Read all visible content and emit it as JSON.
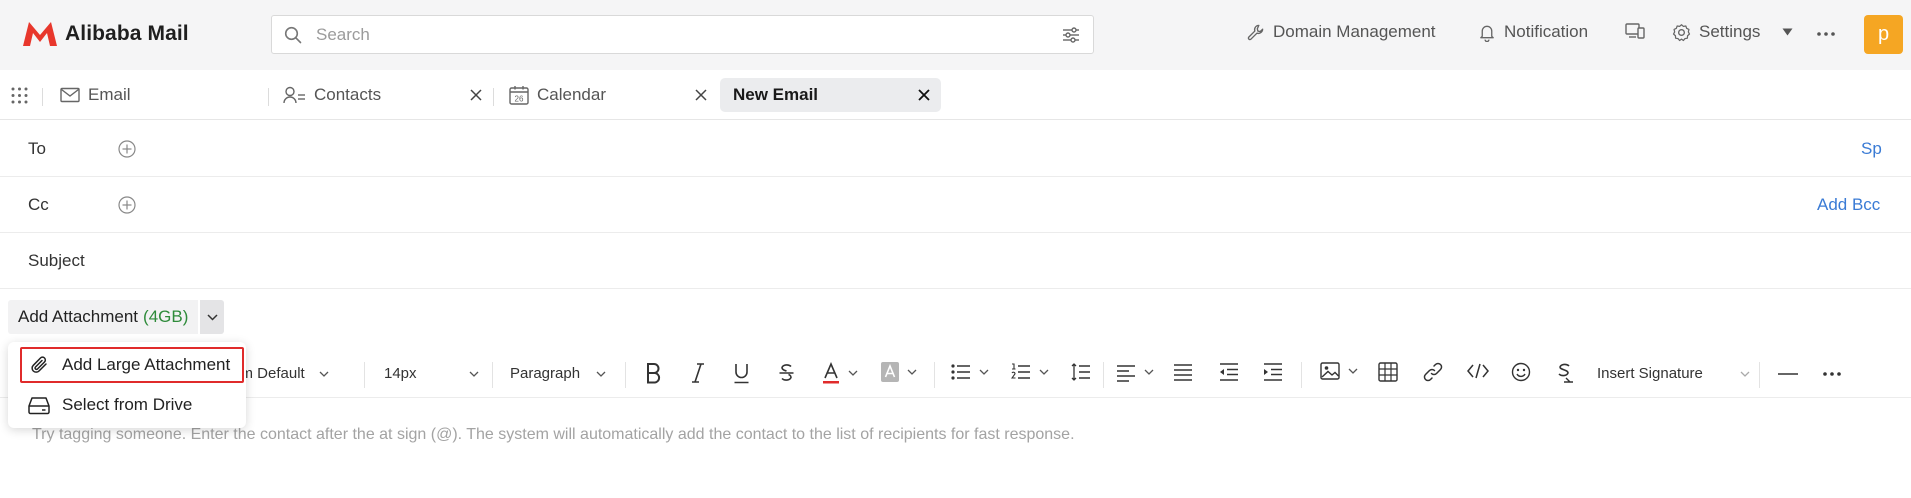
{
  "app": {
    "name": "Alibaba Mail",
    "brand_color": "#e8372c"
  },
  "search": {
    "placeholder": "Search"
  },
  "header": {
    "domain_management": "Domain Management",
    "notification": "Notification",
    "settings": "Settings",
    "avatar_letter": "p",
    "avatar_color": "#f5a623"
  },
  "tabs": [
    {
      "label": "Email",
      "icon": "mail-icon",
      "closable": false
    },
    {
      "label": "Contacts",
      "icon": "contacts-icon",
      "closable": true
    },
    {
      "label": "Calendar",
      "icon": "calendar-icon",
      "calendar_day": "26",
      "closable": true
    },
    {
      "label": "New Email",
      "active": true,
      "closable": true
    }
  ],
  "compose": {
    "to_label": "To",
    "to_right_link": "Sp",
    "cc_label": "Cc",
    "cc_right_link": "Add Bcc",
    "subject_label": "Subject",
    "attach_label": "Add Attachment",
    "attach_size": "(4GB)",
    "body_placeholder": "Try tagging someone. Enter the contact after the at sign (@). The system will automatically add the contact to the list of recipients for fast response."
  },
  "toolbar": {
    "font_family": "tem Default",
    "font_size": "14px",
    "block_format": "Paragraph",
    "insert_signature": "Insert Signature",
    "font_color": "#e02b2b"
  },
  "attach_menu": {
    "items": [
      {
        "label": "Add Large Attachment",
        "icon": "paperclip-icon",
        "highlighted": true
      },
      {
        "label": "Select from Drive",
        "icon": "drive-icon",
        "highlighted": false
      }
    ]
  }
}
